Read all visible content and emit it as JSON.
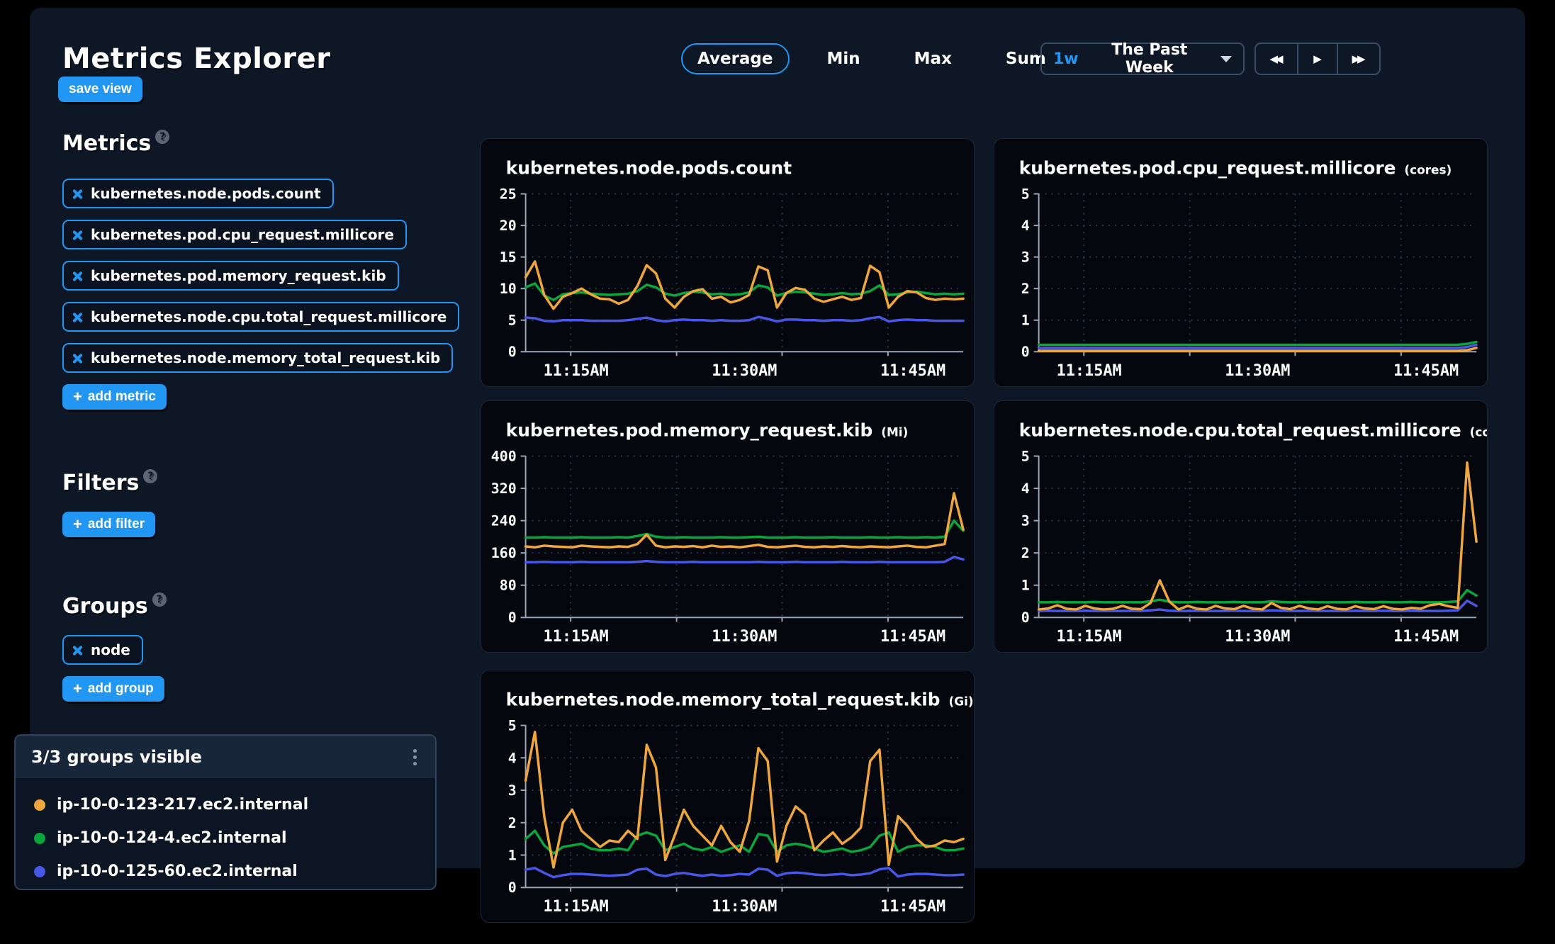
{
  "page": {
    "title": "Metrics Explorer",
    "save_view": "save view"
  },
  "aggregation": {
    "options": [
      "Average",
      "Min",
      "Max",
      "Sum"
    ],
    "selected": "Average"
  },
  "timepicker": {
    "duration": "1w",
    "label": "The Past Week"
  },
  "sidebar": {
    "metrics_heading": "Metrics",
    "metrics": [
      "kubernetes.node.pods.count",
      "kubernetes.pod.cpu_request.millicore",
      "kubernetes.pod.memory_request.kib",
      "kubernetes.node.cpu.total_request.millicore",
      "kubernetes.node.memory_total_request.kib"
    ],
    "add_metric": "add metric",
    "filters_heading": "Filters",
    "add_filter": "add filter",
    "groups_heading": "Groups",
    "groups": [
      "node"
    ],
    "add_group": "add group"
  },
  "legend": {
    "header": "3/3 groups visible",
    "items": [
      {
        "label": "ip-10-0-123-217.ec2.internal",
        "color": "#efa73d"
      },
      {
        "label": "ip-10-0-124-4.ec2.internal",
        "color": "#0aa53c"
      },
      {
        "label": "ip-10-0-125-60.ec2.internal",
        "color": "#4757e6"
      }
    ]
  },
  "colors": {
    "accent": "#2196f3",
    "grid": "#283952",
    "axis": "#9aa5b5",
    "card_bg": "#04070d",
    "panel_bg": "#0d1726"
  },
  "chart_data": [
    {
      "type": "line",
      "title": "kubernetes.node.pods.count",
      "unit": "",
      "ylim": [
        0,
        25
      ],
      "yticks": [
        0,
        5,
        10,
        15,
        20,
        25
      ],
      "xticks": [
        "11:15AM",
        "11:30AM",
        "11:45AM"
      ],
      "series": [
        {
          "name": "ip-10-0-123-217.ec2.internal",
          "color": "#efa73d",
          "values": [
            11.8,
            14.3,
            9.0,
            6.8,
            8.7,
            9.3,
            10.0,
            9.1,
            8.4,
            8.3,
            7.6,
            8.2,
            10.4,
            13.7,
            12.4,
            8.4,
            7.0,
            8.7,
            9.6,
            9.9,
            8.4,
            8.7,
            7.8,
            8.2,
            9.0,
            13.5,
            12.9,
            7.0,
            9.3,
            10.1,
            9.8,
            8.4,
            7.9,
            8.3,
            8.7,
            8.2,
            8.5,
            13.6,
            12.6,
            7.0,
            8.7,
            9.6,
            9.4,
            8.5,
            8.2,
            8.4,
            8.3,
            8.4
          ]
        },
        {
          "name": "ip-10-0-124-4.ec2.internal",
          "color": "#0aa53c",
          "values": [
            10.2,
            10.8,
            8.9,
            8.2,
            9.1,
            9.3,
            9.4,
            9.2,
            9.1,
            9.0,
            9.1,
            9.2,
            9.6,
            10.6,
            10.2,
            9.2,
            8.9,
            9.3,
            9.5,
            9.4,
            9.1,
            9.2,
            9.0,
            9.1,
            9.4,
            10.5,
            10.2,
            8.9,
            9.3,
            9.5,
            9.4,
            9.2,
            9.0,
            9.1,
            9.3,
            9.1,
            9.2,
            9.6,
            10.5,
            9.0,
            9.1,
            9.4,
            9.5,
            9.3,
            9.1,
            9.2,
            9.1,
            9.2
          ]
        },
        {
          "name": "ip-10-0-125-60.ec2.internal",
          "color": "#4757e6",
          "values": [
            5.4,
            5.3,
            4.9,
            4.8,
            5.0,
            5.0,
            5.0,
            4.9,
            4.9,
            4.9,
            4.9,
            5.0,
            5.2,
            5.4,
            5.0,
            4.8,
            5.0,
            5.1,
            5.0,
            5.0,
            4.9,
            5.0,
            4.9,
            4.9,
            5.0,
            5.5,
            5.2,
            4.8,
            5.1,
            5.1,
            5.0,
            5.0,
            4.9,
            5.0,
            5.0,
            4.9,
            5.0,
            5.3,
            5.5,
            4.8,
            5.0,
            5.1,
            5.0,
            5.0,
            4.9,
            4.9,
            4.9,
            4.9
          ]
        }
      ]
    },
    {
      "type": "line",
      "title": "kubernetes.pod.cpu_request.millicore",
      "unit": "(cores)",
      "ylim": [
        0,
        5
      ],
      "yticks": [
        0,
        1,
        2,
        3,
        4,
        5
      ],
      "xticks": [
        "11:15AM",
        "11:30AM",
        "11:45AM"
      ],
      "series": [
        {
          "name": "ip-10-0-123-217.ec2.internal",
          "color": "#efa73d",
          "values": [
            0.03,
            0.03,
            0.03,
            0.03,
            0.03,
            0.03,
            0.03,
            0.03,
            0.03,
            0.03,
            0.03,
            0.03,
            0.03,
            0.03,
            0.03,
            0.03,
            0.03,
            0.03,
            0.03,
            0.03,
            0.03,
            0.03,
            0.03,
            0.03,
            0.03,
            0.03,
            0.03,
            0.03,
            0.03,
            0.03,
            0.03,
            0.03,
            0.03,
            0.03,
            0.03,
            0.03,
            0.03,
            0.03,
            0.03,
            0.03,
            0.03,
            0.03,
            0.03,
            0.03,
            0.03,
            0.03,
            0.05,
            0.12
          ]
        },
        {
          "name": "ip-10-0-124-4.ec2.internal",
          "color": "#0aa53c",
          "values": [
            0.22,
            0.22,
            0.22,
            0.22,
            0.22,
            0.22,
            0.22,
            0.22,
            0.22,
            0.22,
            0.22,
            0.22,
            0.22,
            0.22,
            0.22,
            0.22,
            0.22,
            0.22,
            0.22,
            0.22,
            0.22,
            0.22,
            0.22,
            0.22,
            0.22,
            0.22,
            0.22,
            0.22,
            0.22,
            0.22,
            0.22,
            0.22,
            0.22,
            0.22,
            0.22,
            0.22,
            0.22,
            0.22,
            0.22,
            0.22,
            0.22,
            0.22,
            0.22,
            0.22,
            0.22,
            0.22,
            0.25,
            0.31
          ]
        },
        {
          "name": "ip-10-0-125-60.ec2.internal",
          "color": "#4757e6",
          "values": [
            0.12,
            0.12,
            0.12,
            0.12,
            0.12,
            0.12,
            0.12,
            0.12,
            0.12,
            0.12,
            0.12,
            0.12,
            0.12,
            0.12,
            0.12,
            0.12,
            0.12,
            0.12,
            0.12,
            0.12,
            0.12,
            0.12,
            0.12,
            0.12,
            0.12,
            0.12,
            0.12,
            0.12,
            0.12,
            0.12,
            0.12,
            0.12,
            0.12,
            0.12,
            0.12,
            0.12,
            0.12,
            0.12,
            0.12,
            0.12,
            0.12,
            0.12,
            0.12,
            0.12,
            0.12,
            0.12,
            0.15,
            0.22
          ]
        }
      ]
    },
    {
      "type": "line",
      "title": "kubernetes.pod.memory_request.kib",
      "unit": "(Mi)",
      "ylim": [
        0,
        400
      ],
      "yticks": [
        0,
        80,
        160,
        240,
        320,
        400
      ],
      "xticks": [
        "11:15AM",
        "11:30AM",
        "11:45AM"
      ],
      "series": [
        {
          "name": "ip-10-0-123-217.ec2.internal",
          "color": "#efa73d",
          "values": [
            176,
            174,
            178,
            176,
            175,
            174,
            178,
            176,
            175,
            174,
            176,
            175,
            182,
            205,
            178,
            174,
            176,
            175,
            177,
            174,
            178,
            175,
            176,
            174,
            177,
            180,
            175,
            174,
            176,
            178,
            175,
            174,
            176,
            175,
            177,
            175,
            174,
            176,
            175,
            174,
            176,
            178,
            175,
            174,
            178,
            182,
            308,
            218
          ]
        },
        {
          "name": "ip-10-0-124-4.ec2.internal",
          "color": "#0aa53c",
          "values": [
            198,
            198,
            199,
            198,
            198,
            198,
            199,
            198,
            198,
            198,
            199,
            198,
            202,
            207,
            200,
            198,
            198,
            199,
            198,
            198,
            198,
            199,
            198,
            198,
            199,
            200,
            198,
            198,
            198,
            199,
            198,
            198,
            198,
            199,
            198,
            198,
            198,
            199,
            198,
            198,
            199,
            198,
            198,
            199,
            198,
            200,
            240,
            215
          ]
        },
        {
          "name": "ip-10-0-125-60.ec2.internal",
          "color": "#4757e6",
          "values": [
            137,
            137,
            138,
            137,
            137,
            137,
            138,
            137,
            137,
            137,
            137,
            137,
            138,
            140,
            138,
            137,
            137,
            137,
            138,
            137,
            137,
            137,
            137,
            137,
            137,
            138,
            137,
            137,
            137,
            138,
            137,
            137,
            137,
            137,
            138,
            137,
            137,
            137,
            138,
            137,
            137,
            137,
            137,
            137,
            137,
            138,
            150,
            144
          ]
        }
      ]
    },
    {
      "type": "line",
      "title": "kubernetes.node.cpu.total_request.millicore",
      "unit": "(cores)",
      "ylim": [
        0,
        5
      ],
      "yticks": [
        0,
        1,
        2,
        3,
        4,
        5
      ],
      "xticks": [
        "11:15AM",
        "11:30AM",
        "11:45AM"
      ],
      "series": [
        {
          "name": "ip-10-0-123-217.ec2.internal",
          "color": "#efa73d",
          "values": [
            0.25,
            0.28,
            0.38,
            0.27,
            0.25,
            0.36,
            0.28,
            0.25,
            0.27,
            0.36,
            0.27,
            0.26,
            0.45,
            1.15,
            0.5,
            0.25,
            0.36,
            0.27,
            0.25,
            0.36,
            0.28,
            0.26,
            0.36,
            0.27,
            0.25,
            0.45,
            0.3,
            0.26,
            0.36,
            0.28,
            0.25,
            0.35,
            0.27,
            0.25,
            0.35,
            0.28,
            0.26,
            0.35,
            0.27,
            0.25,
            0.3,
            0.27,
            0.38,
            0.42,
            0.35,
            0.3,
            4.8,
            2.35
          ]
        },
        {
          "name": "ip-10-0-124-4.ec2.internal",
          "color": "#0aa53c",
          "values": [
            0.47,
            0.47,
            0.48,
            0.47,
            0.47,
            0.47,
            0.48,
            0.47,
            0.47,
            0.47,
            0.47,
            0.47,
            0.5,
            0.55,
            0.49,
            0.47,
            0.47,
            0.48,
            0.47,
            0.47,
            0.47,
            0.48,
            0.47,
            0.47,
            0.47,
            0.5,
            0.48,
            0.47,
            0.47,
            0.48,
            0.47,
            0.47,
            0.47,
            0.47,
            0.48,
            0.47,
            0.47,
            0.48,
            0.47,
            0.47,
            0.48,
            0.47,
            0.47,
            0.47,
            0.48,
            0.5,
            0.85,
            0.68
          ]
        },
        {
          "name": "ip-10-0-125-60.ec2.internal",
          "color": "#4757e6",
          "values": [
            0.2,
            0.21,
            0.2,
            0.2,
            0.2,
            0.21,
            0.2,
            0.2,
            0.2,
            0.2,
            0.21,
            0.2,
            0.22,
            0.25,
            0.21,
            0.2,
            0.2,
            0.21,
            0.2,
            0.2,
            0.2,
            0.21,
            0.2,
            0.2,
            0.2,
            0.22,
            0.21,
            0.2,
            0.2,
            0.21,
            0.2,
            0.2,
            0.2,
            0.2,
            0.21,
            0.2,
            0.2,
            0.21,
            0.2,
            0.2,
            0.21,
            0.2,
            0.2,
            0.2,
            0.21,
            0.22,
            0.52,
            0.36
          ]
        }
      ]
    },
    {
      "type": "line",
      "title": "kubernetes.node.memory_total_request.kib",
      "unit": "(Gi)",
      "ylim": [
        0,
        5
      ],
      "yticks": [
        0,
        1,
        2,
        3,
        4,
        5
      ],
      "xticks": [
        "11:15AM",
        "11:30AM",
        "11:45AM"
      ],
      "series": [
        {
          "name": "ip-10-0-123-217.ec2.internal",
          "color": "#efa73d",
          "values": [
            3.3,
            4.8,
            2.2,
            0.62,
            2.0,
            2.4,
            1.75,
            1.5,
            1.25,
            1.45,
            1.4,
            1.75,
            1.5,
            4.4,
            3.7,
            0.85,
            1.6,
            2.4,
            1.9,
            1.6,
            1.3,
            1.9,
            1.4,
            1.1,
            2.05,
            4.3,
            3.9,
            0.8,
            1.9,
            2.5,
            2.25,
            1.15,
            1.45,
            1.7,
            1.35,
            1.55,
            1.85,
            3.9,
            4.25,
            0.7,
            2.2,
            1.9,
            1.5,
            1.25,
            1.3,
            1.45,
            1.4,
            1.5
          ]
        },
        {
          "name": "ip-10-0-124-4.ec2.internal",
          "color": "#0aa53c",
          "values": [
            1.5,
            1.75,
            1.3,
            1.05,
            1.25,
            1.3,
            1.35,
            1.2,
            1.15,
            1.15,
            1.2,
            1.15,
            1.6,
            1.7,
            1.6,
            1.15,
            1.25,
            1.35,
            1.2,
            1.15,
            1.25,
            1.1,
            1.2,
            1.3,
            1.1,
            1.65,
            1.6,
            1.1,
            1.3,
            1.35,
            1.3,
            1.2,
            1.1,
            1.15,
            1.2,
            1.1,
            1.15,
            1.25,
            1.6,
            1.7,
            1.1,
            1.25,
            1.3,
            1.3,
            1.25,
            1.15,
            1.15,
            1.2
          ]
        },
        {
          "name": "ip-10-0-125-60.ec2.internal",
          "color": "#4757e6",
          "values": [
            0.55,
            0.6,
            0.45,
            0.32,
            0.38,
            0.42,
            0.42,
            0.4,
            0.38,
            0.36,
            0.38,
            0.4,
            0.55,
            0.58,
            0.4,
            0.35,
            0.42,
            0.45,
            0.4,
            0.36,
            0.4,
            0.36,
            0.38,
            0.42,
            0.4,
            0.58,
            0.55,
            0.36,
            0.44,
            0.46,
            0.44,
            0.4,
            0.38,
            0.4,
            0.42,
            0.38,
            0.4,
            0.44,
            0.56,
            0.6,
            0.34,
            0.4,
            0.42,
            0.42,
            0.4,
            0.38,
            0.38,
            0.4
          ]
        }
      ]
    }
  ]
}
